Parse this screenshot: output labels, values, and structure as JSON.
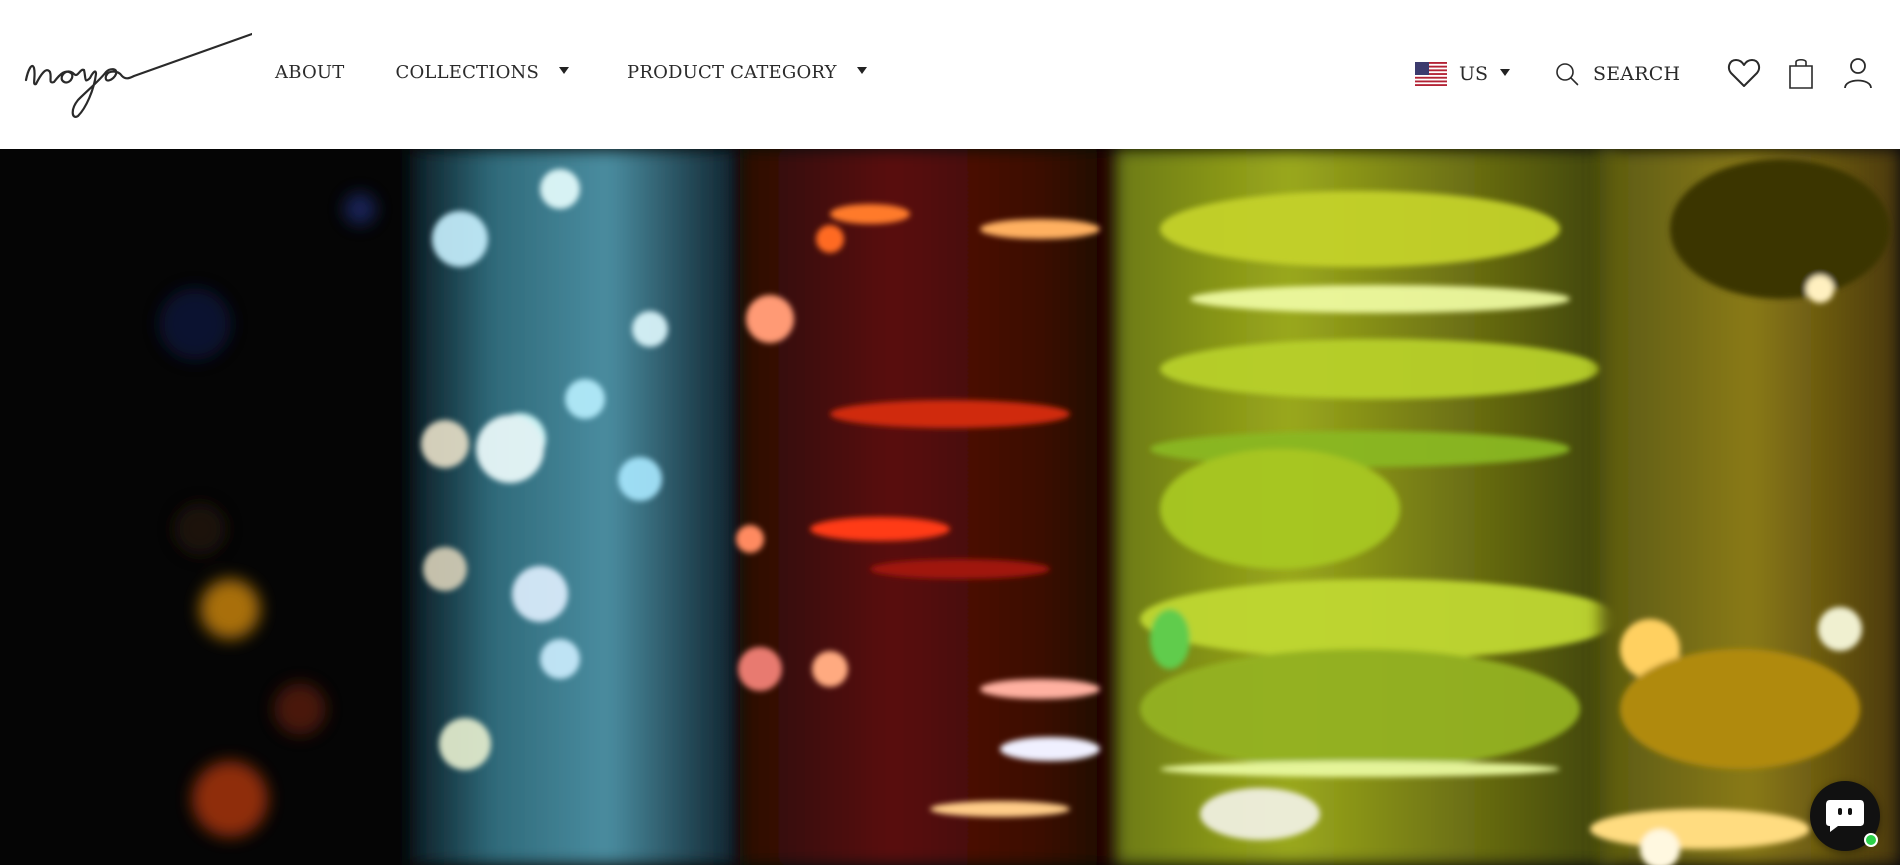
{
  "brand": {
    "logo_text": "noya"
  },
  "nav": {
    "items": [
      {
        "label": "ABOUT",
        "has_dropdown": false
      },
      {
        "label": "COLLECTIONS",
        "has_dropdown": true
      },
      {
        "label": "PRODUCT CATEGORY",
        "has_dropdown": true
      }
    ]
  },
  "locale": {
    "country": "US",
    "flag_icon": "us-flag-icon"
  },
  "search": {
    "label": "SEARCH",
    "icon": "search-icon"
  },
  "header_icons": {
    "wishlist": "heart-icon",
    "cart": "shopping-bag-icon",
    "account": "user-icon"
  },
  "hero": {
    "image": "blurred colorful glass bottles"
  },
  "chat": {
    "icon": "chat-bubble-icon",
    "status": "online",
    "status_color": "#2bd14a"
  },
  "colors": {
    "header_bg": "#ffffff",
    "text": "#2a2a2a",
    "hero_bg": "#050505"
  }
}
